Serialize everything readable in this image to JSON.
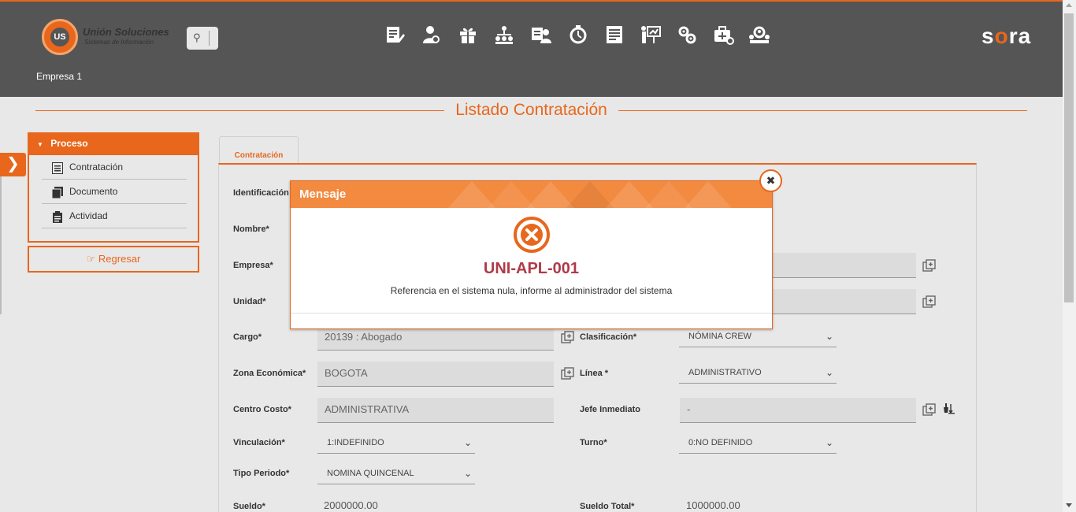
{
  "brand": {
    "logo_mark": "UNIÓN US",
    "name": "Unión Soluciones",
    "tagline": "Sistemas de Información",
    "product": "sora",
    "accent": "#e8671c",
    "header_bg": "#555555"
  },
  "header": {
    "company": "Empresa 1",
    "search_icon": "search-icon",
    "modules": [
      {
        "icon": "edit-document-icon"
      },
      {
        "icon": "user-settings-icon"
      },
      {
        "icon": "gift-icon"
      },
      {
        "icon": "org-chart-icon"
      },
      {
        "icon": "user-badge-icon"
      },
      {
        "icon": "stopwatch-icon"
      },
      {
        "icon": "report-list-icon"
      },
      {
        "icon": "presentation-icon"
      },
      {
        "icon": "gears-icon"
      },
      {
        "icon": "medical-kit-icon"
      },
      {
        "icon": "team-search-icon"
      }
    ]
  },
  "page": {
    "title": "Listado Contratación"
  },
  "sidebar": {
    "toggle_icon": "chevron-right-icon",
    "section_label": "Proceso",
    "items": [
      {
        "label": "Contratación",
        "icon": "list-icon"
      },
      {
        "label": "Documento",
        "icon": "document-icon"
      },
      {
        "label": "Actividad",
        "icon": "clipboard-icon"
      }
    ],
    "back_label": "Regresar"
  },
  "form": {
    "tab_label": "Contratación",
    "identificacion_label": "Identificación",
    "nombre_label": "Nombre*",
    "empresa_label": "Empresa*",
    "unidad_label": "Unidad*",
    "cargo_label": "Cargo*",
    "cargo_value": "20139   : Abogado",
    "zona_label": "Zona Económica*",
    "zona_value": "BOGOTA",
    "centro_label": "Centro Costo*",
    "centro_value": "ADMINISTRATIVA",
    "vinculacion_label": "Vinculación*",
    "vinculacion_value": "1:INDEFINIDO",
    "tipo_periodo_label": "Tipo Periodo*",
    "tipo_periodo_value": "NOMINA QUINCENAL",
    "sueldo_label": "Sueldo*",
    "sueldo_value": "2000000.00",
    "clasificacion_label": "Clasificación*",
    "clasificacion_value": "NÓMINA CREW",
    "linea_label": "Línea *",
    "linea_value": "ADMINISTRATIVO",
    "jefe_label": "Jefe Inmediato",
    "jefe_value": "-",
    "turno_label": "Turno*",
    "turno_value": "0:NO DEFINIDO",
    "sueldo_total_label": "Sueldo Total*",
    "sueldo_total_value": "1000000.00"
  },
  "modal": {
    "title": "Mensaje",
    "code": "UNI-APL-001",
    "message": "Referencia en el sistema nula, informe al administrador del sistema",
    "close_symbol": "✖",
    "icon": "error-circle-icon",
    "code_color": "#b03a48"
  }
}
